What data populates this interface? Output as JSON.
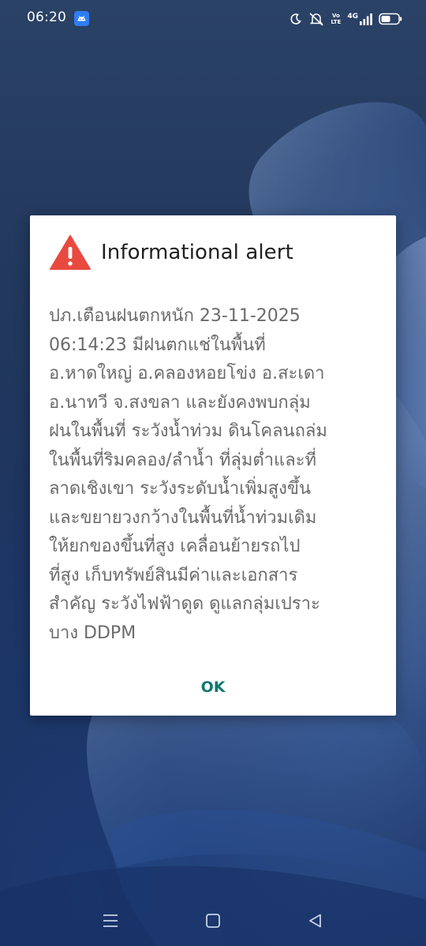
{
  "status_bar": {
    "time": "06:20",
    "volte_top": "Vo",
    "volte_bottom": "LTE",
    "network": "4G"
  },
  "dialog": {
    "title": "Informational alert",
    "message": "ปภ.เตือนฝนตกหนัก  23-11-2025\n06:14:23 มีฝนตกแช่ในพื้นที่\nอ.หาดใหญ่ อ.คลองหอยโข่ง อ.สะเดา\nอ.นาทวี จ.สงขลา และยังคงพบกลุ่ม\nฝนในพื้นที่ ระวังน้ำท่วม ดินโคลนถล่ม\nในพื้นที่ริมคลอง/ลำน้ำ ที่ลุ่มต่ำและที่\nลาดเชิงเขา ระวังระดับน้ำเพิ่มสูงขึ้น\nและขยายวงกว้างในพื้นที่น้ำท่วมเดิม\nให้ยกของขึ้นที่สูง เคลื่อนย้ายรถไป\nที่สูง เก็บทรัพย์สินมีค่าและเอกสาร\nสำคัญ ระวังไฟฟ้าดูด ดูแลกลุ่มเปราะ\nบาง DDPM",
    "ok_label": "OK"
  },
  "colors": {
    "alert_icon": "#e84a3f",
    "ok_text": "#0f7a70",
    "message_text": "#6b6b6b"
  },
  "icons": [
    "android-icon",
    "moon-icon",
    "bell-muted-icon",
    "signal-icon",
    "battery-icon",
    "warning-icon",
    "menu-icon",
    "home-icon",
    "back-icon"
  ]
}
